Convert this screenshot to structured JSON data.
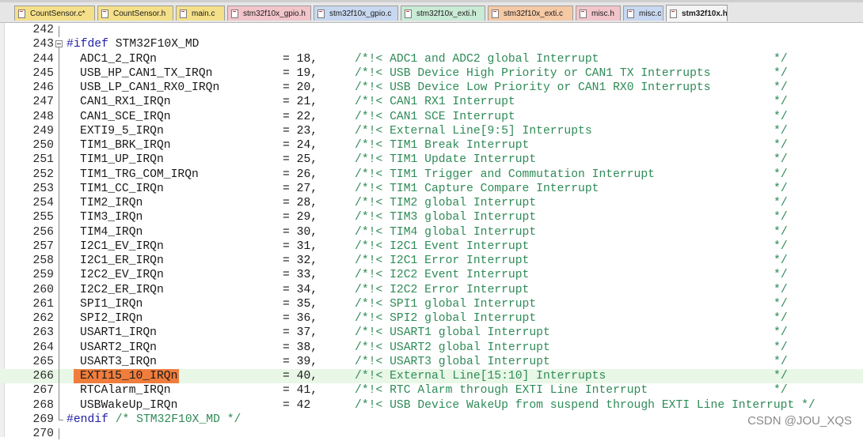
{
  "tabs": [
    {
      "label": "CountSensor.c*",
      "color": "#f5e08a"
    },
    {
      "label": "CountSensor.h",
      "color": "#f5e08a"
    },
    {
      "label": "main.c",
      "color": "#f5e08a"
    },
    {
      "label": "stm32f10x_gpio.h",
      "color": "#f2c5cb"
    },
    {
      "label": "stm32f10x_gpio.c",
      "color": "#c8d8f0"
    },
    {
      "label": "stm32f10x_exti.h",
      "color": "#c9ead5"
    },
    {
      "label": "stm32f10x_exti.c",
      "color": "#f6c9a5"
    },
    {
      "label": "misc.h",
      "color": "#f2c5cb"
    },
    {
      "label": "misc.c",
      "color": "#c8d8f0"
    },
    {
      "label": "stm32f10x.h",
      "color": "#f4f4f4",
      "active": true
    }
  ],
  "code": {
    "first_line": "242",
    "ifdef_line": "243",
    "ifdef_text": "#ifdef",
    "ifdef_symbol": "STM32F10X_MD",
    "entries": [
      {
        "line": "244",
        "name": "ADC1_2_IRQn",
        "value": "= 18,",
        "comment": "/*!< ADC1 and ADC2 global Interrupt",
        "end": "*/"
      },
      {
        "line": "245",
        "name": "USB_HP_CAN1_TX_IRQn",
        "value": "= 19,",
        "comment": "/*!< USB Device High Priority or CAN1 TX Interrupts",
        "end": "*/"
      },
      {
        "line": "246",
        "name": "USB_LP_CAN1_RX0_IRQn",
        "value": "= 20,",
        "comment": "/*!< USB Device Low Priority or CAN1 RX0 Interrupts",
        "end": "*/"
      },
      {
        "line": "247",
        "name": "CAN1_RX1_IRQn",
        "value": "= 21,",
        "comment": "/*!< CAN1 RX1 Interrupt",
        "end": "*/"
      },
      {
        "line": "248",
        "name": "CAN1_SCE_IRQn",
        "value": "= 22,",
        "comment": "/*!< CAN1 SCE Interrupt",
        "end": "*/"
      },
      {
        "line": "249",
        "name": "EXTI9_5_IRQn",
        "value": "= 23,",
        "comment": "/*!< External Line[9:5] Interrupts",
        "end": "*/"
      },
      {
        "line": "250",
        "name": "TIM1_BRK_IRQn",
        "value": "= 24,",
        "comment": "/*!< TIM1 Break Interrupt",
        "end": "*/"
      },
      {
        "line": "251",
        "name": "TIM1_UP_IRQn",
        "value": "= 25,",
        "comment": "/*!< TIM1 Update Interrupt",
        "end": "*/"
      },
      {
        "line": "252",
        "name": "TIM1_TRG_COM_IRQn",
        "value": "= 26,",
        "comment": "/*!< TIM1 Trigger and Commutation Interrupt",
        "end": "*/"
      },
      {
        "line": "253",
        "name": "TIM1_CC_IRQn",
        "value": "= 27,",
        "comment": "/*!< TIM1 Capture Compare Interrupt",
        "end": "*/"
      },
      {
        "line": "254",
        "name": "TIM2_IRQn",
        "value": "= 28,",
        "comment": "/*!< TIM2 global Interrupt",
        "end": "*/"
      },
      {
        "line": "255",
        "name": "TIM3_IRQn",
        "value": "= 29,",
        "comment": "/*!< TIM3 global Interrupt",
        "end": "*/"
      },
      {
        "line": "256",
        "name": "TIM4_IRQn",
        "value": "= 30,",
        "comment": "/*!< TIM4 global Interrupt",
        "end": "*/"
      },
      {
        "line": "257",
        "name": "I2C1_EV_IRQn",
        "value": "= 31,",
        "comment": "/*!< I2C1 Event Interrupt",
        "end": "*/"
      },
      {
        "line": "258",
        "name": "I2C1_ER_IRQn",
        "value": "= 32,",
        "comment": "/*!< I2C1 Error Interrupt",
        "end": "*/"
      },
      {
        "line": "259",
        "name": "I2C2_EV_IRQn",
        "value": "= 33,",
        "comment": "/*!< I2C2 Event Interrupt",
        "end": "*/"
      },
      {
        "line": "260",
        "name": "I2C2_ER_IRQn",
        "value": "= 34,",
        "comment": "/*!< I2C2 Error Interrupt",
        "end": "*/"
      },
      {
        "line": "261",
        "name": "SPI1_IRQn",
        "value": "= 35,",
        "comment": "/*!< SPI1 global Interrupt",
        "end": "*/"
      },
      {
        "line": "262",
        "name": "SPI2_IRQn",
        "value": "= 36,",
        "comment": "/*!< SPI2 global Interrupt",
        "end": "*/"
      },
      {
        "line": "263",
        "name": "USART1_IRQn",
        "value": "= 37,",
        "comment": "/*!< USART1 global Interrupt",
        "end": "*/"
      },
      {
        "line": "264",
        "name": "USART2_IRQn",
        "value": "= 38,",
        "comment": "/*!< USART2 global Interrupt",
        "end": "*/"
      },
      {
        "line": "265",
        "name": "USART3_IRQn",
        "value": "= 39,",
        "comment": "/*!< USART3 global Interrupt",
        "end": "*/"
      },
      {
        "line": "266",
        "name": "EXTI15_10_IRQn",
        "value": "= 40,",
        "comment": "/*!< External Line[15:10] Interrupts",
        "end": "*/",
        "current": true
      },
      {
        "line": "267",
        "name": "RTCAlarm_IRQn",
        "value": "= 41,",
        "comment": "/*!< RTC Alarm through EXTI Line Interrupt",
        "end": "*/"
      },
      {
        "line": "268",
        "name": "USBWakeUp_IRQn",
        "value": "= 42",
        "comment": "/*!< USB Device WakeUp from suspend through EXTI Line Interrupt */",
        "end": ""
      }
    ],
    "endif_line": "269",
    "endif_text": "#endif",
    "endif_comment": "/* STM32F10X_MD */",
    "last_line": "270"
  },
  "colors": {
    "comment": "#2e8b57",
    "preprocessor": "#1f1fa5",
    "current_line_bg": "#e8f7e6",
    "selection": "#f07d3c"
  },
  "watermark": "CSDN @JOU_XQS"
}
